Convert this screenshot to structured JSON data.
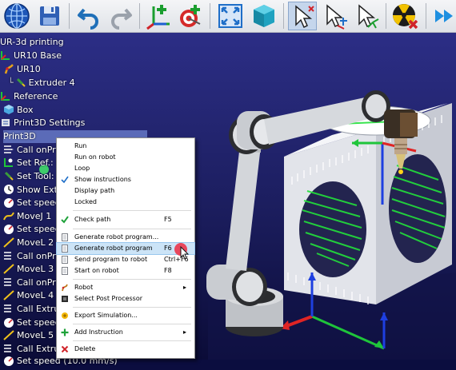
{
  "toolbar": {
    "buttons": [
      {
        "icon": "globe-icon"
      },
      {
        "icon": "save-icon"
      },
      {
        "icon": "undo-icon"
      },
      {
        "icon": "redo-icon"
      },
      {
        "icon": "add-frame-icon"
      },
      {
        "icon": "add-target-icon"
      },
      {
        "icon": "fit-all-icon"
      },
      {
        "icon": "cube-view-icon"
      },
      {
        "icon": "select-icon"
      },
      {
        "icon": "select-add-icon"
      },
      {
        "icon": "select-move-icon"
      },
      {
        "icon": "collision-icon"
      },
      {
        "icon": "fast-forward-icon"
      }
    ]
  },
  "tree": {
    "items": [
      {
        "label": "UR-3d printing",
        "icon": "station-icon"
      },
      {
        "label": "UR10 Base",
        "icon": "frame-icon"
      },
      {
        "label": "UR10",
        "icon": "robot-icon"
      },
      {
        "label": "Extruder 4",
        "icon": "tool-icon"
      },
      {
        "label": "Reference",
        "icon": "frame-icon"
      },
      {
        "label": "Box",
        "icon": "box-icon"
      },
      {
        "label": "Print3D Settings",
        "icon": "settings-icon"
      },
      {
        "label": "Print3D",
        "icon": "program-icon"
      },
      {
        "label": "Call onPrin",
        "icon": "call-icon"
      },
      {
        "label": "Set Ref.: Re",
        "icon": "ref-icon"
      },
      {
        "label": "Set Tool: Ex",
        "icon": "tool-icon"
      },
      {
        "label": "Show Extru",
        "icon": "show-icon"
      },
      {
        "label": "Set speed",
        "icon": "speed-icon"
      },
      {
        "label": "MoveJ 1",
        "icon": "movej-icon"
      },
      {
        "label": "Set speed",
        "icon": "speed-icon"
      },
      {
        "label": "MoveL 2",
        "icon": "movel-icon"
      },
      {
        "label": "Call onPrin",
        "icon": "call-icon"
      },
      {
        "label": "MoveL 3",
        "icon": "movel-icon"
      },
      {
        "label": "Call onPrin",
        "icon": "call-icon"
      },
      {
        "label": "MoveL 4",
        "icon": "movel-icon"
      },
      {
        "label": "Call Extrud",
        "icon": "call-icon"
      },
      {
        "label": "Set speed",
        "icon": "speed-icon"
      },
      {
        "label": "MoveL 5",
        "icon": "movel-icon"
      },
      {
        "label": "Call Extrud",
        "icon": "call-icon"
      },
      {
        "label": "Set speed (10.0 mm/s)",
        "icon": "speed-icon"
      }
    ],
    "selected_index": 7
  },
  "menu": {
    "items": [
      {
        "label": "Run",
        "key": "",
        "icon": ""
      },
      {
        "label": "Run on robot",
        "key": "",
        "icon": ""
      },
      {
        "label": "Loop",
        "key": "",
        "icon": ""
      },
      {
        "label": "Show instructions",
        "key": "",
        "icon": "check-icon",
        "checked": true
      },
      {
        "label": "Display path",
        "key": "",
        "icon": ""
      },
      {
        "label": "Locked",
        "key": "",
        "icon": ""
      },
      {
        "label": "Check path",
        "key": "F5",
        "icon": "green-check-icon"
      },
      {
        "label": "Generate robot program...",
        "key": "",
        "icon": "doc-icon"
      },
      {
        "label": "Generate robot program",
        "key": "F6",
        "icon": "doc-icon",
        "highlighted": true
      },
      {
        "label": "Send program to robot",
        "key": "Ctrl+F6",
        "icon": "doc-icon"
      },
      {
        "label": "Start on robot",
        "key": "F8",
        "icon": "doc-icon"
      },
      {
        "label": "Robot",
        "key": "",
        "icon": "robot-icon",
        "submenu": true
      },
      {
        "label": "Select Post Processor",
        "key": "",
        "icon": "post-icon"
      },
      {
        "label": "Export Simulation...",
        "key": "",
        "icon": "export-icon"
      },
      {
        "label": "Add Instruction",
        "key": "",
        "icon": "plus-icon",
        "submenu": true
      },
      {
        "label": "Delete",
        "key": "",
        "icon": "delete-icon"
      }
    ],
    "submenu_arrow": "▸"
  },
  "colors": {
    "toolbar_bg": "#e8eaee",
    "viewport_top": "#2c2e86",
    "viewport_bottom": "#0b0c38",
    "menu_highlight": "#cce4f7",
    "selection": "#5b6bb8"
  }
}
